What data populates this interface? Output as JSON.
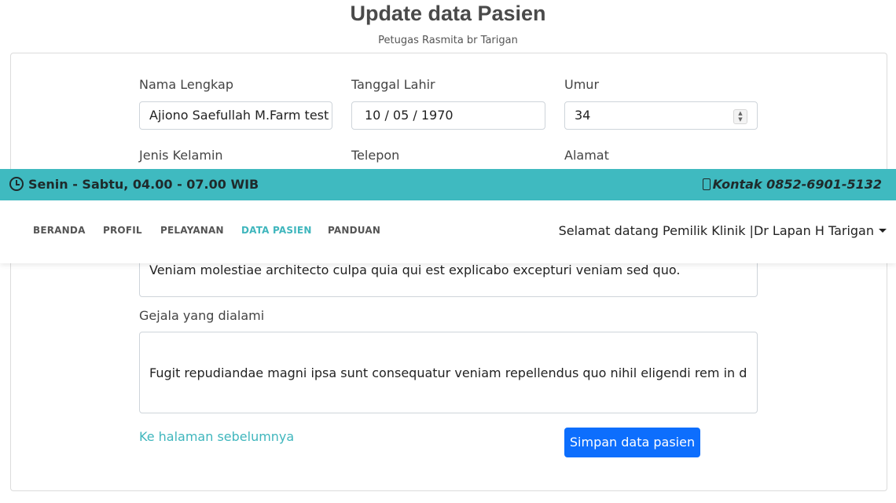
{
  "page": {
    "title": "Update data Pasien",
    "subtitle": "Petugas Rasmita br Tarigan"
  },
  "form": {
    "nama_label": "Nama Lengkap",
    "nama_value": "Ajiono Saefullah M.Farm test",
    "tanggal_label": "Tanggal Lahir",
    "tanggal_value": "10 / 05 / 1970",
    "umur_label": "Umur",
    "umur_value": "34",
    "jenis_kelamin_label": "Jenis Kelamin",
    "telepon_label": "Telepon",
    "alamat_label": "Alamat",
    "keterangan_value": "Veniam molestiae architecto culpa quia qui est explicabo excepturi veniam sed quo.",
    "gejala_label": "Gejala yang dialami",
    "gejala_value": "Fugit repudiandae magni ipsa sunt consequatur veniam repellendus quo nihil eligendi rem in doloribus",
    "back_link": "Ke halaman sebelumnya",
    "save_button": "Simpan data pasien"
  },
  "topbar": {
    "hours": "Senin - Sabtu, 04.00 - 07.00 WIB",
    "contact": "Kontak 0852-6901-5132"
  },
  "nav": {
    "items": [
      "BERANDA",
      "PROFIL",
      "PELAYANAN",
      "DATA PASIEN",
      "PANDUAN"
    ],
    "active": "DATA PASIEN",
    "welcome": "Selamat datang Pemilik Klinik |Dr Lapan H Tarigan"
  },
  "colors": {
    "accent": "#3fb6bd",
    "topbar": "#3fbac0",
    "primary_button": "#0d6efd"
  },
  "icons": {
    "clock": "clock-icon",
    "phone": "mobile-phone-icon",
    "dropdown": "caret-down-icon"
  }
}
